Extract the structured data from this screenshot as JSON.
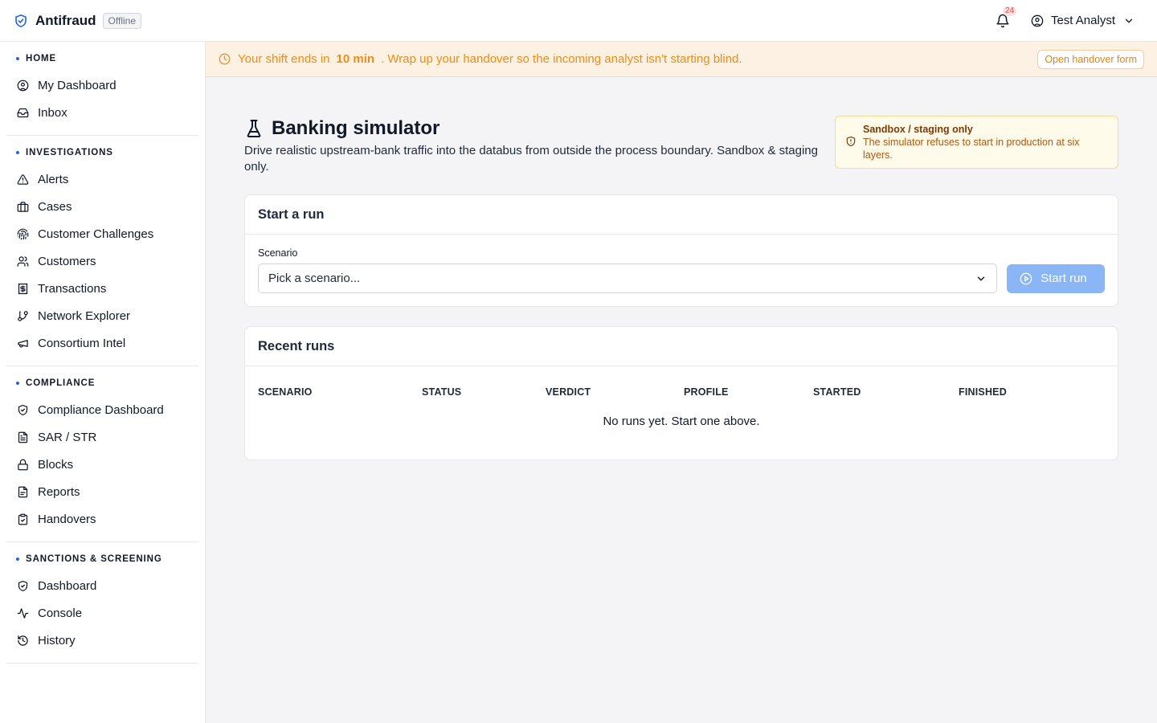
{
  "header": {
    "app_name": "Antifraud",
    "status_badge": "Offline",
    "notification_count": "24",
    "user_name": "Test Analyst"
  },
  "sidebar": {
    "sections": [
      {
        "title": "HOME",
        "items": [
          {
            "label": "My Dashboard",
            "icon": "user-circle-icon"
          },
          {
            "label": "Inbox",
            "icon": "inbox-icon"
          }
        ]
      },
      {
        "title": "INVESTIGATIONS",
        "items": [
          {
            "label": "Alerts",
            "icon": "alert-triangle-icon"
          },
          {
            "label": "Cases",
            "icon": "briefcase-icon"
          },
          {
            "label": "Customer Challenges",
            "icon": "fingerprint-icon"
          },
          {
            "label": "Customers",
            "icon": "users-icon"
          },
          {
            "label": "Transactions",
            "icon": "receipt-icon"
          },
          {
            "label": "Network Explorer",
            "icon": "git-branch-icon"
          },
          {
            "label": "Consortium Intel",
            "icon": "megaphone-icon"
          }
        ]
      },
      {
        "title": "COMPLIANCE",
        "items": [
          {
            "label": "Compliance Dashboard",
            "icon": "shield-check-icon"
          },
          {
            "label": "SAR / STR",
            "icon": "file-text-icon"
          },
          {
            "label": "Blocks",
            "icon": "lock-icon"
          },
          {
            "label": "Reports",
            "icon": "file-icon"
          },
          {
            "label": "Handovers",
            "icon": "clipboard-check-icon"
          }
        ]
      },
      {
        "title": "SANCTIONS & SCREENING",
        "items": [
          {
            "label": "Dashboard",
            "icon": "shield-check-icon"
          },
          {
            "label": "Console",
            "icon": "activity-icon"
          },
          {
            "label": "History",
            "icon": "history-icon"
          }
        ]
      }
    ]
  },
  "shift_banner": {
    "prefix": "Your shift ends in",
    "time": "10 min",
    "suffix": ". Wrap up your handover so the incoming analyst isn't starting blind.",
    "button": "Open handover form"
  },
  "page": {
    "title": "Banking simulator",
    "description": "Drive realistic upstream-bank traffic into the databus from outside the process boundary. Sandbox & staging only."
  },
  "sandbox_notice": {
    "title": "Sandbox / staging only",
    "text": "The simulator refuses to start in production at six layers."
  },
  "start_run": {
    "heading": "Start a run",
    "scenario_label": "Scenario",
    "scenario_value": "Pick a scenario...",
    "button": "Start run"
  },
  "recent_runs": {
    "heading": "Recent runs",
    "columns": [
      "SCENARIO",
      "STATUS",
      "VERDICT",
      "PROFILE",
      "STARTED",
      "FINISHED"
    ],
    "empty_text": "No runs yet. Start one above."
  },
  "colors": {
    "accent": "#2563eb",
    "warning": "#f08c14",
    "button_disabled": "#8bb6f6"
  }
}
